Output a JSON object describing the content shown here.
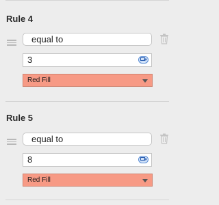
{
  "rules": [
    {
      "title": "Rule 4",
      "condition": "equal to",
      "value": "3",
      "format": "Red Fill"
    },
    {
      "title": "Rule 5",
      "condition": "equal to",
      "value": "8",
      "format": "Red Fill"
    }
  ],
  "colors": {
    "format_fill": "#f79a85",
    "accent": "#5d8fd6"
  },
  "icons": {
    "drag": "drag-handle-icon",
    "delete": "trash-icon",
    "reference": "cell-reference-icon",
    "dropdown": "chevron-down-icon"
  }
}
